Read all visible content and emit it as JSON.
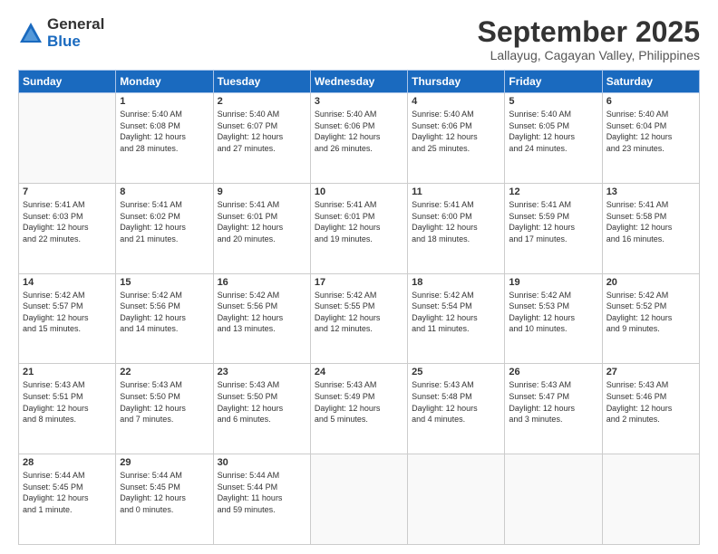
{
  "logo": {
    "general": "General",
    "blue": "Blue"
  },
  "title": "September 2025",
  "subtitle": "Lallayug, Cagayan Valley, Philippines",
  "headers": [
    "Sunday",
    "Monday",
    "Tuesday",
    "Wednesday",
    "Thursday",
    "Friday",
    "Saturday"
  ],
  "weeks": [
    [
      {
        "day": "",
        "info": ""
      },
      {
        "day": "1",
        "info": "Sunrise: 5:40 AM\nSunset: 6:08 PM\nDaylight: 12 hours\nand 28 minutes."
      },
      {
        "day": "2",
        "info": "Sunrise: 5:40 AM\nSunset: 6:07 PM\nDaylight: 12 hours\nand 27 minutes."
      },
      {
        "day": "3",
        "info": "Sunrise: 5:40 AM\nSunset: 6:06 PM\nDaylight: 12 hours\nand 26 minutes."
      },
      {
        "day": "4",
        "info": "Sunrise: 5:40 AM\nSunset: 6:06 PM\nDaylight: 12 hours\nand 25 minutes."
      },
      {
        "day": "5",
        "info": "Sunrise: 5:40 AM\nSunset: 6:05 PM\nDaylight: 12 hours\nand 24 minutes."
      },
      {
        "day": "6",
        "info": "Sunrise: 5:40 AM\nSunset: 6:04 PM\nDaylight: 12 hours\nand 23 minutes."
      }
    ],
    [
      {
        "day": "7",
        "info": "Sunrise: 5:41 AM\nSunset: 6:03 PM\nDaylight: 12 hours\nand 22 minutes."
      },
      {
        "day": "8",
        "info": "Sunrise: 5:41 AM\nSunset: 6:02 PM\nDaylight: 12 hours\nand 21 minutes."
      },
      {
        "day": "9",
        "info": "Sunrise: 5:41 AM\nSunset: 6:01 PM\nDaylight: 12 hours\nand 20 minutes."
      },
      {
        "day": "10",
        "info": "Sunrise: 5:41 AM\nSunset: 6:01 PM\nDaylight: 12 hours\nand 19 minutes."
      },
      {
        "day": "11",
        "info": "Sunrise: 5:41 AM\nSunset: 6:00 PM\nDaylight: 12 hours\nand 18 minutes."
      },
      {
        "day": "12",
        "info": "Sunrise: 5:41 AM\nSunset: 5:59 PM\nDaylight: 12 hours\nand 17 minutes."
      },
      {
        "day": "13",
        "info": "Sunrise: 5:41 AM\nSunset: 5:58 PM\nDaylight: 12 hours\nand 16 minutes."
      }
    ],
    [
      {
        "day": "14",
        "info": "Sunrise: 5:42 AM\nSunset: 5:57 PM\nDaylight: 12 hours\nand 15 minutes."
      },
      {
        "day": "15",
        "info": "Sunrise: 5:42 AM\nSunset: 5:56 PM\nDaylight: 12 hours\nand 14 minutes."
      },
      {
        "day": "16",
        "info": "Sunrise: 5:42 AM\nSunset: 5:56 PM\nDaylight: 12 hours\nand 13 minutes."
      },
      {
        "day": "17",
        "info": "Sunrise: 5:42 AM\nSunset: 5:55 PM\nDaylight: 12 hours\nand 12 minutes."
      },
      {
        "day": "18",
        "info": "Sunrise: 5:42 AM\nSunset: 5:54 PM\nDaylight: 12 hours\nand 11 minutes."
      },
      {
        "day": "19",
        "info": "Sunrise: 5:42 AM\nSunset: 5:53 PM\nDaylight: 12 hours\nand 10 minutes."
      },
      {
        "day": "20",
        "info": "Sunrise: 5:42 AM\nSunset: 5:52 PM\nDaylight: 12 hours\nand 9 minutes."
      }
    ],
    [
      {
        "day": "21",
        "info": "Sunrise: 5:43 AM\nSunset: 5:51 PM\nDaylight: 12 hours\nand 8 minutes."
      },
      {
        "day": "22",
        "info": "Sunrise: 5:43 AM\nSunset: 5:50 PM\nDaylight: 12 hours\nand 7 minutes."
      },
      {
        "day": "23",
        "info": "Sunrise: 5:43 AM\nSunset: 5:50 PM\nDaylight: 12 hours\nand 6 minutes."
      },
      {
        "day": "24",
        "info": "Sunrise: 5:43 AM\nSunset: 5:49 PM\nDaylight: 12 hours\nand 5 minutes."
      },
      {
        "day": "25",
        "info": "Sunrise: 5:43 AM\nSunset: 5:48 PM\nDaylight: 12 hours\nand 4 minutes."
      },
      {
        "day": "26",
        "info": "Sunrise: 5:43 AM\nSunset: 5:47 PM\nDaylight: 12 hours\nand 3 minutes."
      },
      {
        "day": "27",
        "info": "Sunrise: 5:43 AM\nSunset: 5:46 PM\nDaylight: 12 hours\nand 2 minutes."
      }
    ],
    [
      {
        "day": "28",
        "info": "Sunrise: 5:44 AM\nSunset: 5:45 PM\nDaylight: 12 hours\nand 1 minute."
      },
      {
        "day": "29",
        "info": "Sunrise: 5:44 AM\nSunset: 5:45 PM\nDaylight: 12 hours\nand 0 minutes."
      },
      {
        "day": "30",
        "info": "Sunrise: 5:44 AM\nSunset: 5:44 PM\nDaylight: 11 hours\nand 59 minutes."
      },
      {
        "day": "",
        "info": ""
      },
      {
        "day": "",
        "info": ""
      },
      {
        "day": "",
        "info": ""
      },
      {
        "day": "",
        "info": ""
      }
    ]
  ]
}
